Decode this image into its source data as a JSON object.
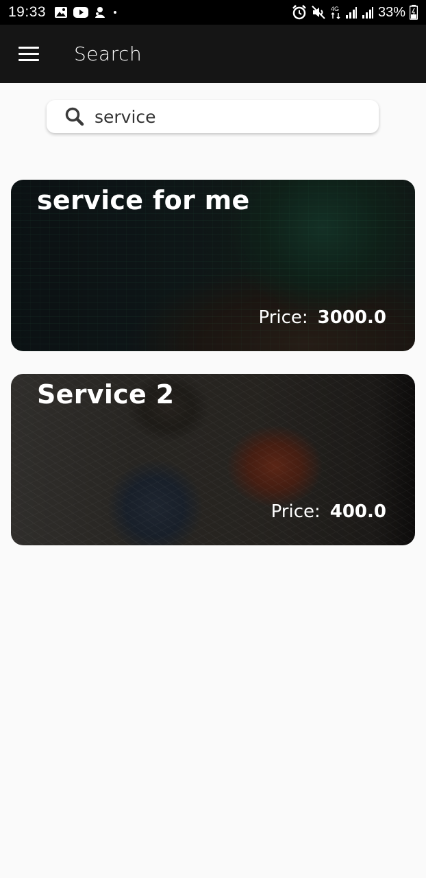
{
  "status_bar": {
    "time": "19:33",
    "battery_percent": "33%",
    "network": "4G",
    "left_icons": [
      "image-icon",
      "youtube-icon",
      "notification-icon",
      "dot-icon"
    ],
    "right_icons": [
      "alarm-icon",
      "mute-icon",
      "network-4g-icon",
      "signal-icon",
      "signal-icon",
      "battery-icon"
    ]
  },
  "app_bar": {
    "title": "Search",
    "background": "#151515"
  },
  "search": {
    "value": "service"
  },
  "results": [
    {
      "title": "service for me",
      "price_label": "Price:",
      "price_value": "3000.0"
    },
    {
      "title": "Service 2",
      "price_label": "Price:",
      "price_value": "400.0"
    }
  ]
}
